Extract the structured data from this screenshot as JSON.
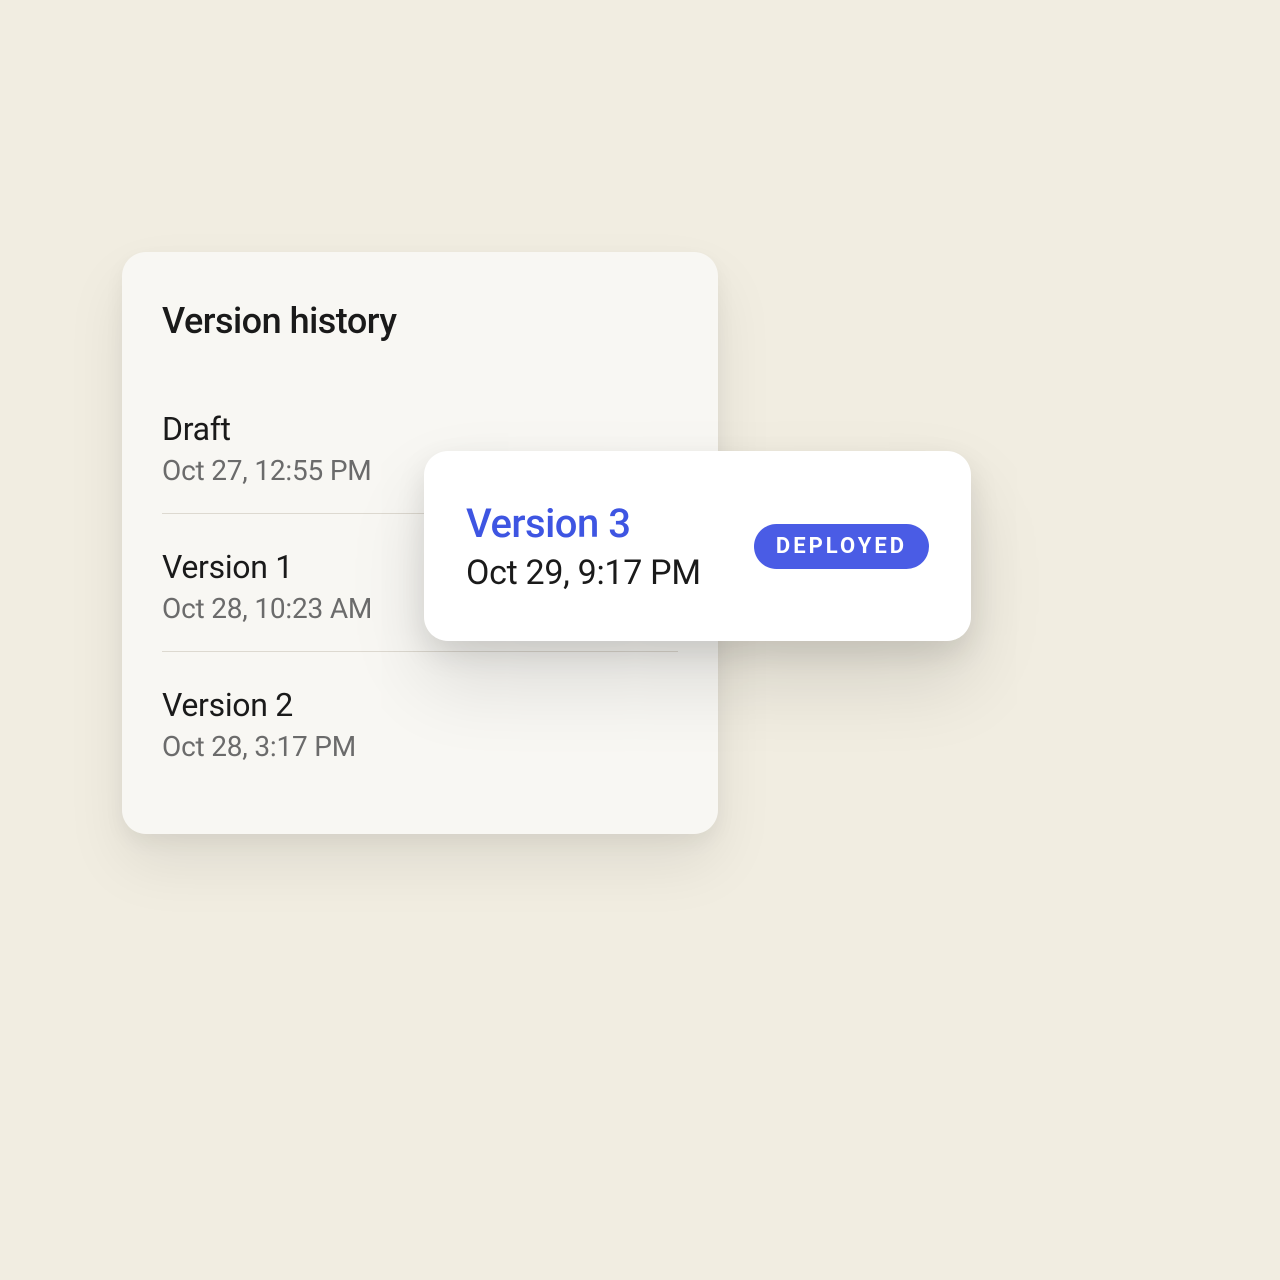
{
  "card": {
    "title": "Version history",
    "items": [
      {
        "name": "Draft",
        "date": "Oct 27, 12:55 PM"
      },
      {
        "name": "Version 1",
        "date": "Oct 28, 10:23 AM"
      },
      {
        "name": "Version 2",
        "date": "Oct 28, 3:17 PM"
      }
    ]
  },
  "floating": {
    "name": "Version 3",
    "date": "Oct 29, 9:17 PM",
    "badge": "DEPLOYED"
  }
}
